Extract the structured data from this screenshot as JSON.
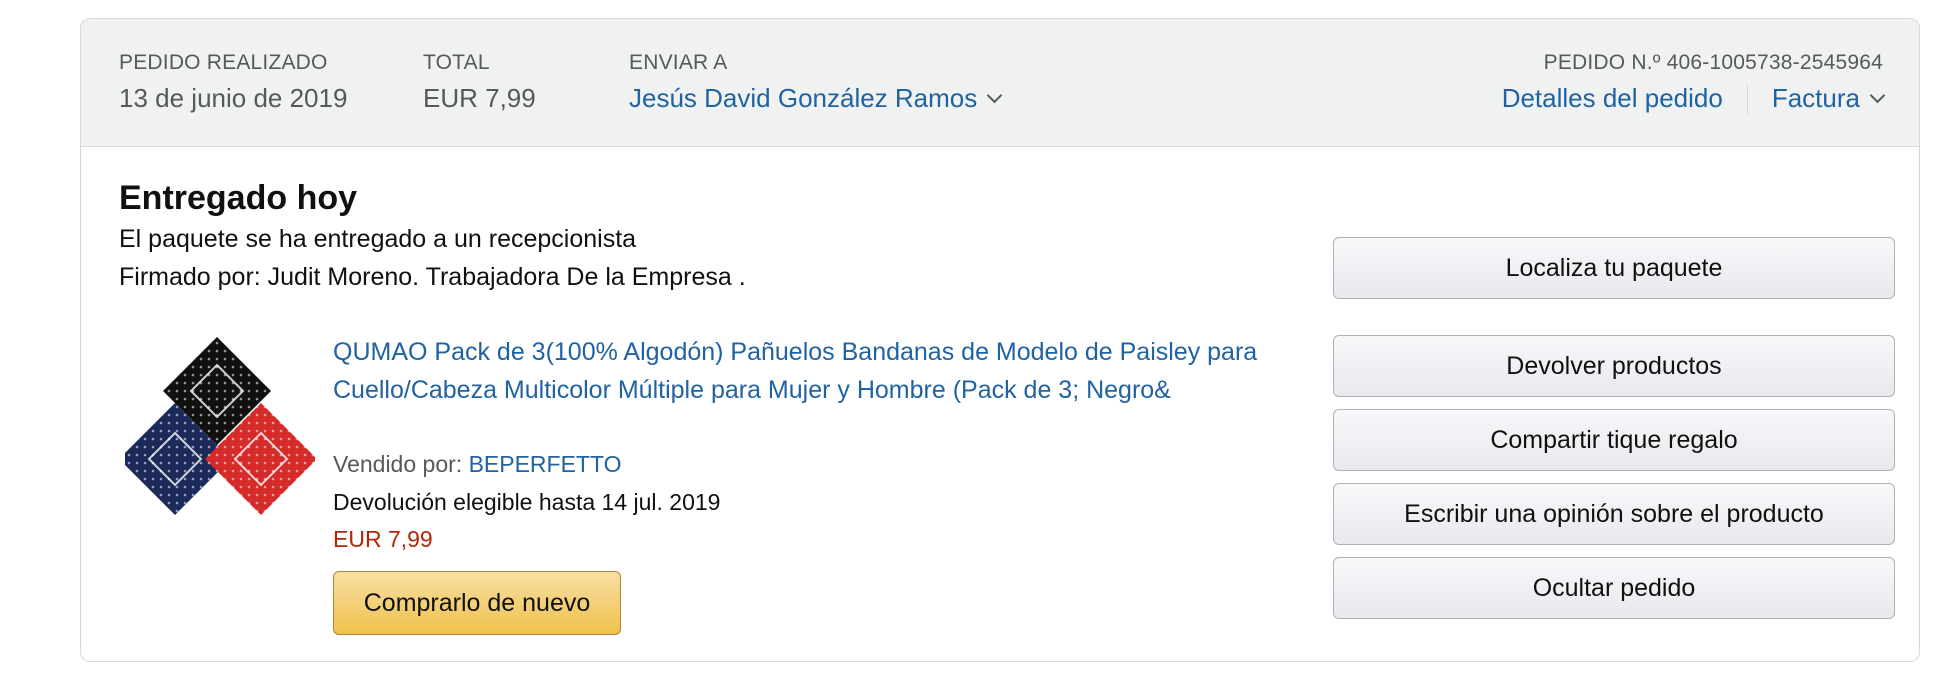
{
  "header": {
    "placed": {
      "label": "PEDIDO REALIZADO",
      "value": "13 de junio de 2019"
    },
    "total": {
      "label": "TOTAL",
      "value": "EUR 7,99"
    },
    "ship_to": {
      "label": "ENVIAR A",
      "value": "Jesús David González Ramos"
    },
    "order_number": {
      "label": "PEDIDO N.º 406-1005738-2545964"
    },
    "order_details_link": "Detalles del pedido",
    "invoice_link": "Factura"
  },
  "shipment": {
    "status": "Entregado hoy",
    "detail_1": "El paquete se ha entregado a un recepcionista",
    "detail_2": "Firmado por: Judit Moreno. Trabajadora De la Empresa ."
  },
  "item": {
    "title": "QUMAO Pack de 3(100% Algodón) Pañuelos Bandanas de Modelo de Paisley para Cuello/Cabeza Multicolor Múltiple para Mujer y Hombre (Pack de 3; Negro&",
    "sold_by_label": "Vendido por:",
    "seller": "BEPERFETTO",
    "return_note": "Devolución elegible hasta 14 jul. 2019",
    "price": "EUR 7,99",
    "buy_again_label": "Comprarlo de nuevo",
    "image_colors": [
      "#111111",
      "#1c2a5a",
      "#d42a2a"
    ]
  },
  "actions": [
    "Localiza tu paquete",
    "Devolver productos",
    "Compartir tique regalo",
    "Escribir una opinión sobre el producto",
    "Ocultar pedido"
  ]
}
